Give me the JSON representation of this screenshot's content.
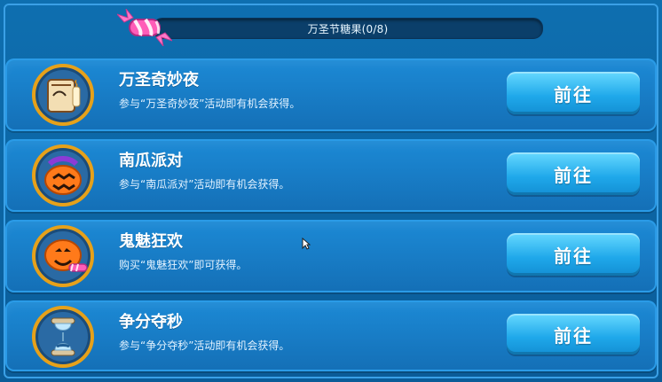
{
  "header": {
    "title": "万圣节糖果(0/8)",
    "progress": {
      "current": 0,
      "total": 8
    },
    "icon": "candy-icon"
  },
  "rows": [
    {
      "title": "万圣奇妙夜",
      "desc": "参与“万圣奇妙夜”活动即有机会获得。",
      "button": "前往",
      "icon": "candle-scroll-icon"
    },
    {
      "title": "南瓜派对",
      "desc": "参与“南瓜派对”活动即有机会获得。",
      "button": "前往",
      "icon": "pumpkin-bag-icon"
    },
    {
      "title": "鬼魅狂欢",
      "desc": "购买“鬼魅狂欢”即可获得。",
      "button": "前往",
      "icon": "jack-o-lantern-candy-icon"
    },
    {
      "title": "争分夺秒",
      "desc": "参与“争分夺秒”活动即有机会获得。",
      "button": "前往",
      "icon": "hourglass-icon"
    }
  ],
  "colors": {
    "panel": "#146fb6",
    "panel_border": "#2a9be7",
    "button": "#1fa8ea",
    "button_highlight": "#66d9ff",
    "text": "#ffffff"
  }
}
